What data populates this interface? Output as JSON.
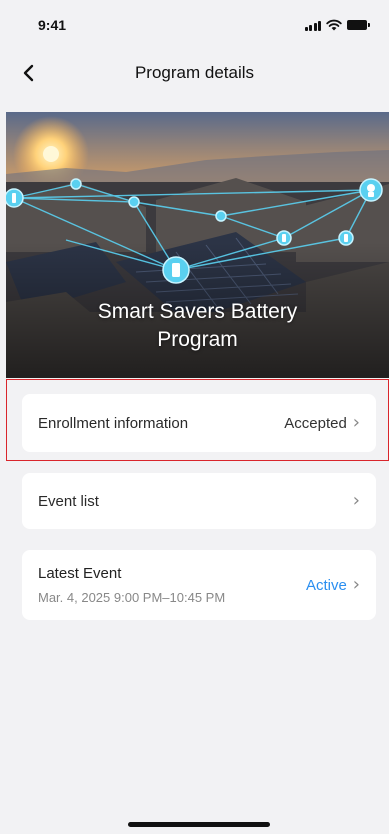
{
  "status_bar": {
    "time": "9:41"
  },
  "nav": {
    "title": "Program details",
    "back_icon": "chevron-left-icon"
  },
  "hero": {
    "title": "Smart Savers Battery Program"
  },
  "enrollment": {
    "label": "Enrollment information",
    "status": "Accepted"
  },
  "event_list": {
    "label": "Event list"
  },
  "latest_event": {
    "label": "Latest Event",
    "time": "Mar. 4, 2025 9:00 PM–10:45 PM",
    "status": "Active",
    "status_color": "#2a8ef0"
  },
  "colors": {
    "background": "#f2f2f4",
    "highlight": "#d9262c",
    "accent": "#2a8ef0"
  }
}
